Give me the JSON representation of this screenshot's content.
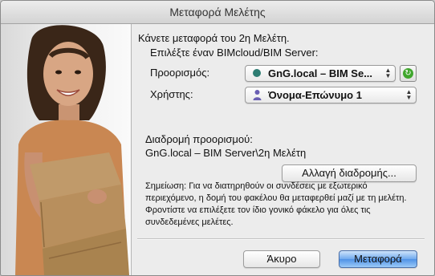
{
  "window": {
    "title": "Μεταφορά Μελέτης"
  },
  "intro": "Κάνετε μεταφορά του 2η Μελέτη.",
  "server_prompt": "Επιλέξτε έναν BIMcloud/BIM Server:",
  "destination": {
    "label": "Προορισμός:",
    "value": "GnG.local – BIM Se..."
  },
  "user": {
    "label": "Χρήστης:",
    "value": "Όνομα-Επώνυμο 1"
  },
  "path": {
    "label": "Διαδρομή προορισμού:",
    "value": "GnG.local – BIM Server\\2η Μελέτη"
  },
  "change_path_button": "Αλλαγή διαδρομής...",
  "note": "Σημείωση: Για να διατηρηθούν οι συνδέσεις με εξωτερικό περιεχόμενο, η δομή του φακέλου θα μεταφερθεί μαζί με τη μελέτη. Φροντίστε να επιλέξετε τον ίδιο γονικό φάκελο για όλες τις συνδεδεμένες μελέτες.",
  "buttons": {
    "cancel": "Άκυρο",
    "transfer": "Μεταφορά"
  },
  "colors": {
    "status_dot": "#2e7d73",
    "refresh": "#3fa62c"
  }
}
